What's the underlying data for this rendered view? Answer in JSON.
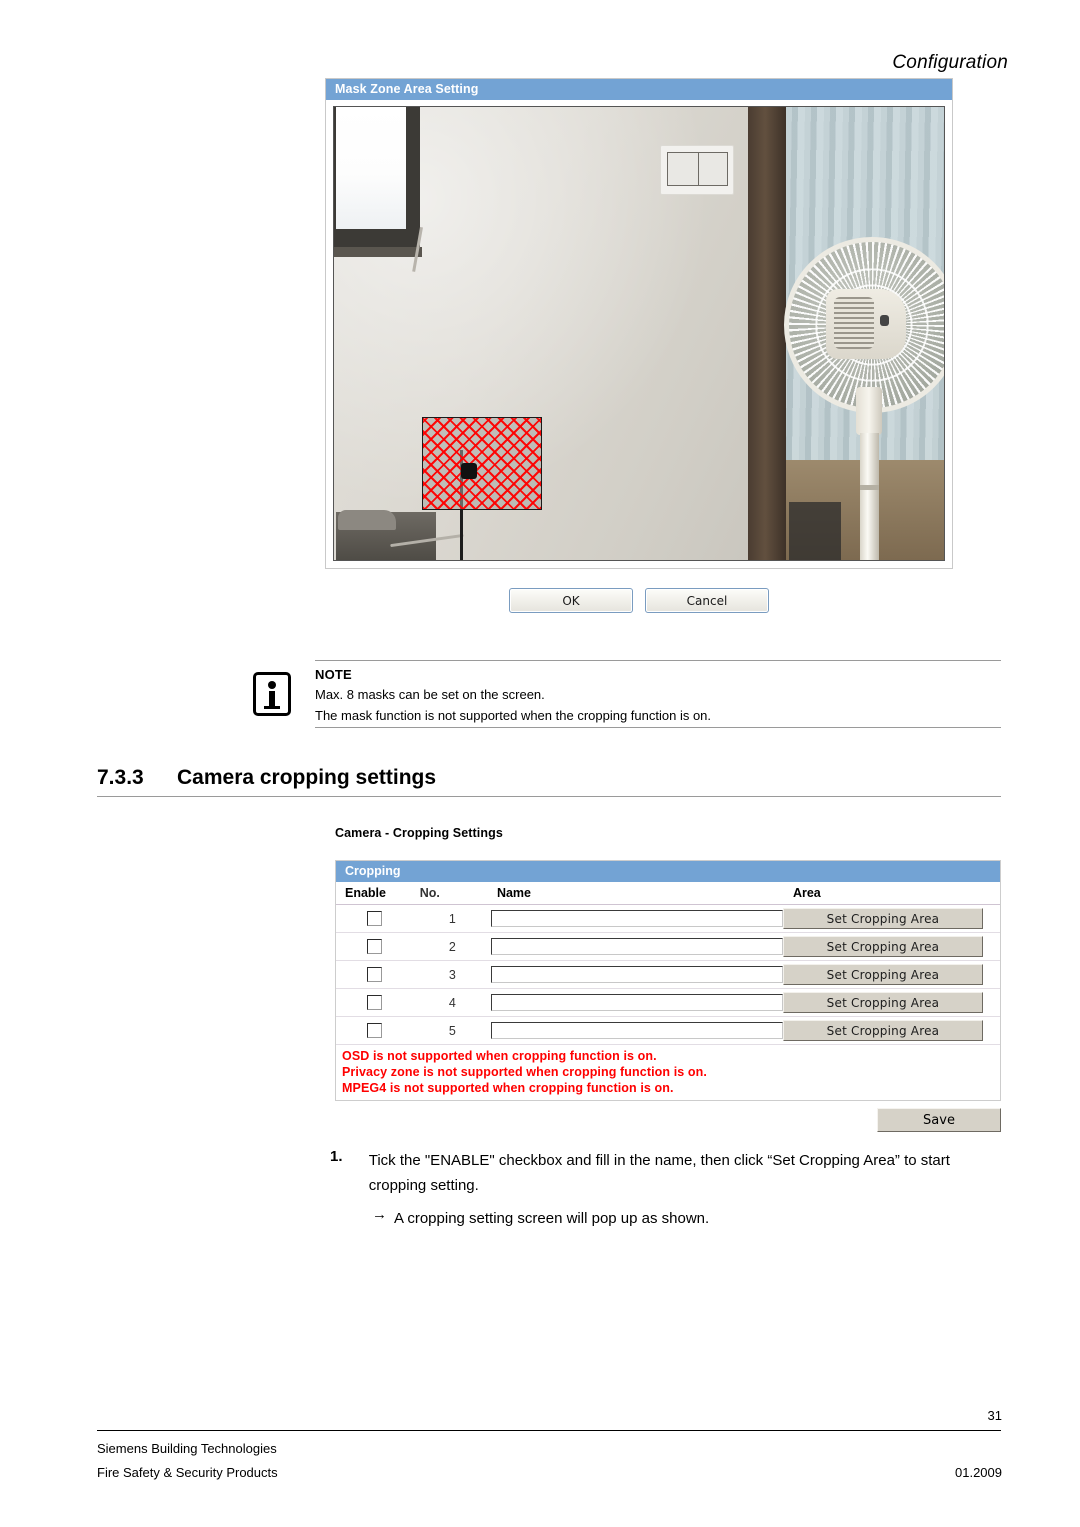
{
  "page": {
    "header_right": "Configuration",
    "number": "31"
  },
  "mask_dialog": {
    "title": "Mask Zone Area Setting",
    "camera_view_alt": "camera-live-view",
    "mask_region_alt": "red-hatched-mask-zone",
    "buttons": {
      "ok": "OK",
      "cancel": "Cancel"
    }
  },
  "note": {
    "title": "NOTE",
    "icon": "info-icon",
    "lines": [
      "Max. 8 masks can be set on the screen.",
      "The mask function is not supported when the cropping function is on."
    ]
  },
  "section": {
    "number": "7.3.3",
    "title": "Camera cropping settings"
  },
  "cropping": {
    "caption": "Camera - Cropping Settings",
    "panel_title": "Cropping",
    "columns": [
      "Enable",
      "No.",
      "Name",
      "Area"
    ],
    "rows": [
      {
        "no": "1",
        "enabled": false,
        "name": "",
        "button": "Set Cropping Area"
      },
      {
        "no": "2",
        "enabled": false,
        "name": "",
        "button": "Set Cropping Area"
      },
      {
        "no": "3",
        "enabled": false,
        "name": "",
        "button": "Set Cropping Area"
      },
      {
        "no": "4",
        "enabled": false,
        "name": "",
        "button": "Set Cropping Area"
      },
      {
        "no": "5",
        "enabled": false,
        "name": "",
        "button": "Set Cropping Area"
      }
    ],
    "warnings": [
      "OSD is not supported when cropping function is on.",
      "Privacy zone is not supported when cropping function is on.",
      "MPEG4 is not supported when cropping function is on."
    ],
    "save_label": "Save"
  },
  "steps": [
    {
      "number": "1.",
      "text": "Tick the \"ENABLE\" checkbox and fill in the name, then click “Set Cropping Area” to start cropping setting.",
      "arrow": "→",
      "arrow_text": "A cropping setting screen will pop up as shown."
    }
  ],
  "footer": {
    "line1": "Siemens Building Technologies",
    "line2": "Fire Safety & Security Products",
    "right": "01.2009"
  },
  "colors": {
    "title_bar_blue": "#73a3d4",
    "warning_red": "#ff0000",
    "button_face": "#d6d2c8"
  }
}
